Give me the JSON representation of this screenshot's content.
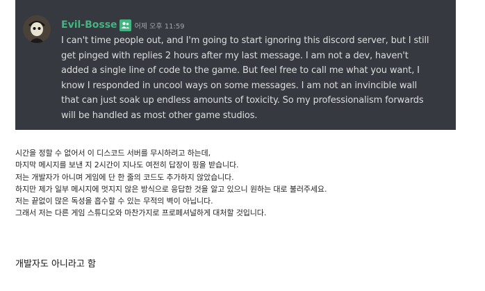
{
  "message": {
    "username": "Evil-Bosse",
    "timestamp": "어제 오후 11:59",
    "lines": [
      "I can't time people out, and I'm going to start ignoring this discord server, but I still",
      "get pinged with replies 2 hours after my last message. I am not a dev, haven't",
      "added a single line of code to the game. But feel free to call me what you want, I",
      "know I responded in uncool ways on some messages. I am not an invincible wall",
      "that can just soak up endless amounts of toxicity. So my professionalism forwards",
      "will be handled as most other game studios."
    ]
  },
  "translation": {
    "lines": [
      "시간을 정할 수 없어서 이 디스코드 서버를 무시하려고 하는데,",
      "마지막 메시지를 보낸 지 2시간이 지나도 여전히 답장이 핑을 받습니다.",
      "저는 개발자가 아니며 게임에 단 한 줄의 코드도 추가하지 않았습니다.",
      "하지만 제가 일부 메시지에 멋지지 않은 방식으로 응답한 것을 알고 있으니 원하는 대로 불러주세요.",
      "저는 끝없이 많은 독성을 흡수할 수 있는 무적의 벽이 아닙니다.",
      "그래서 저는 다른 게임 스튜디오와 마찬가지로 프로페셔널하게 대처할 것입니다."
    ]
  },
  "comment": "개발자도 아니라고 함",
  "colors": {
    "discord_bg": "#36393f",
    "username": "#43b581",
    "message_text": "#dcddde",
    "timestamp": "#a3a6aa"
  },
  "icons": {
    "avatar": "character-avatar",
    "role": "role-badge-icon"
  }
}
